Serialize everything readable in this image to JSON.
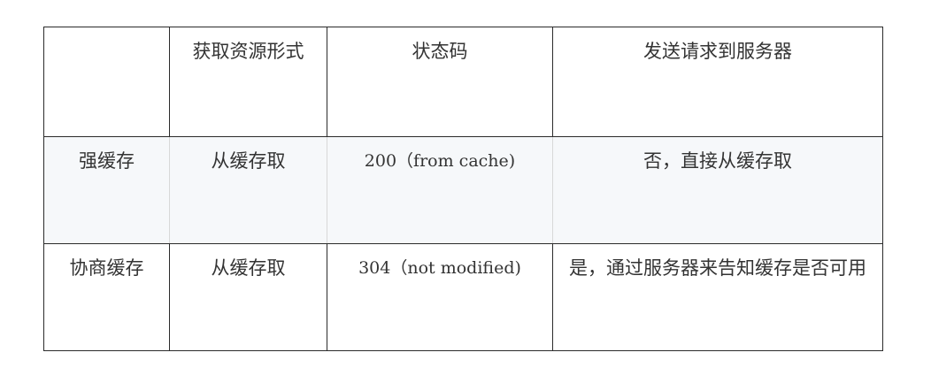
{
  "table": {
    "headers": [
      "",
      "获取资源形式",
      "状态码",
      "发送请求到服务器"
    ],
    "rows": [
      [
        "强缓存",
        "从缓存取",
        "200（from cache)",
        "否，直接从缓存取"
      ],
      [
        "协商缓存",
        "从缓存取",
        "304（not modified)",
        "是，通过服务器来告知缓存是否可用"
      ]
    ]
  }
}
